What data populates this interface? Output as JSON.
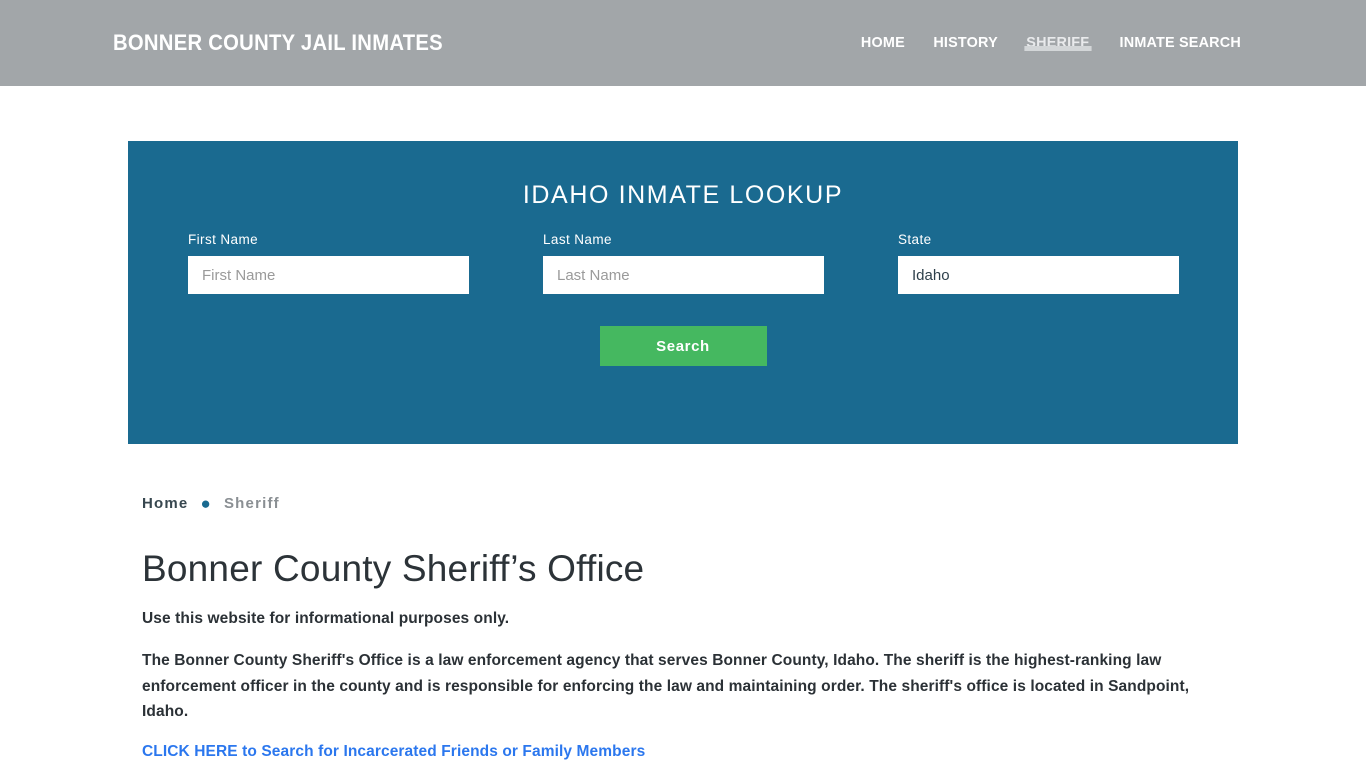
{
  "header": {
    "site_title": "BONNER COUNTY JAIL INMATES",
    "nav": [
      {
        "label": "HOME",
        "active": false
      },
      {
        "label": "HISTORY",
        "active": false
      },
      {
        "label": "SHERIFF",
        "active": true
      },
      {
        "label": "INMATE SEARCH",
        "active": false
      }
    ],
    "background_color": "#a2a6a9"
  },
  "lookup": {
    "title": "IDAHO INMATE LOOKUP",
    "panel_color": "#1a6a90",
    "fields": {
      "first": {
        "label": "First Name",
        "placeholder": "First Name",
        "value": ""
      },
      "last": {
        "label": "Last Name",
        "placeholder": "Last Name",
        "value": ""
      },
      "state": {
        "label": "State",
        "placeholder": "Idaho",
        "value": "Idaho",
        "options": [
          "Idaho"
        ]
      }
    },
    "search_button": {
      "label": "Search",
      "color": "#45b860"
    }
  },
  "breadcrumb": {
    "home_label": "Home",
    "separator": "●",
    "current_label": "Sheriff",
    "separator_color": "#1a6a90"
  },
  "main": {
    "page_title": "Bonner County Sheriff’s Office",
    "lead": "Use this website for informational purposes only.",
    "paragraph": "The Bonner County Sheriff's Office is a law enforcement agency that serves Bonner County, Idaho. The sheriff is the highest-ranking law enforcement officer in the county and is responsible for enforcing the law and maintaining order. The sheriff's office is located in Sandpoint, Idaho.",
    "cta_link": "CLICK HERE to Search for Incarcerated Friends or Family Members",
    "cta_color": "#2b77ee"
  }
}
